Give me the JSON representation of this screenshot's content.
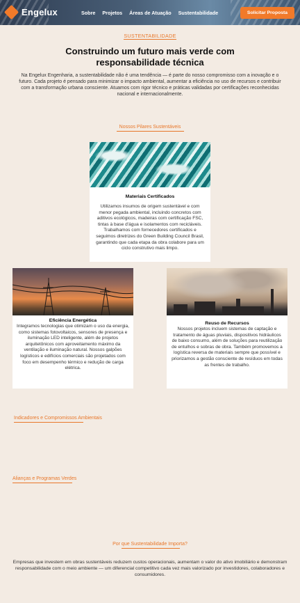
{
  "header": {
    "brand": "Engelux",
    "nav": [
      "Sobre",
      "Projetos",
      "Áreas de Atuação",
      "Sustentabilidade"
    ],
    "cta": "Solicitar Proposta"
  },
  "intro": {
    "eyebrow": "SUSTENTABILIDADE",
    "title": "Construindo um futuro mais verde com responsabilidade técnica",
    "text": "Na Engelux Engenharia, a sustentabilidade não é uma tendência — é parte do nosso compromisso com a inovação e o futuro. Cada projeto é pensado para minimizar o impacto ambiental, aumentar a eficiência no uso de recursos e contribuir com a transformação urbana consciente. Atuamos com rigor técnico e práticas validadas por certificações reconhecidas nacional e internacionalmente."
  },
  "pillars": {
    "heading": "Nossos Pilares Sustentáveis",
    "cards": [
      {
        "title": "Materiais Certificados",
        "text": "Utilizamos insumos de origem sustentável e com menor pegada ambiental, incluindo concretos com aditivos ecológicos, madeiras com certificação FSC, tintas à base d'água e isolamentos com recicláveis. Trabalhamos com fornecedores certificados e seguimos diretrizes do Green Building Council Brasil, garantindo que cada etapa da obra colabore para um ciclo construtivo mais limpo."
      },
      {
        "title": "Eficiência Energética",
        "text": "Integramos tecnologias que otimizam o uso da energia, como sistemas fotovoltaicos, sensores de presença e iluminação LED inteligente, além de projetos arquitetônicos com aproveitamento máximo da ventilação e iluminação natural. Nossos galpões logísticos e edifícios comerciais são projetados com foco em desempenho térmico e redução de carga elétrica."
      },
      {
        "title": "Reuso de Recursos",
        "text": "Nossos projetos incluem sistemas de captação e tratamento de águas pluviais, dispositivos hidráulicos de baixo consumo, além de soluções para reutilização de entulhos e sobras de obra. Também promovemos a logística reversa de materiais sempre que possível e priorizamos a gestão consciente de resíduos em todas as frentes de trabalho."
      }
    ]
  },
  "indicators": {
    "heading": "Indicadores e Compromissos Ambientais"
  },
  "alliances": {
    "heading": "Alianças e Programas Verdes"
  },
  "why": {
    "heading": "Por que Sustentabilidade Importa?",
    "text": "Empresas que investem em obras sustentáveis reduzem custos operacionais, aumentam o valor do ativo imobiliário e demonstram responsabilidade com o meio ambiente — um diferencial competitivo cada vez mais valorizado por investidores, colaboradores e consumidores."
  },
  "colors": {
    "accent": "#f17a2a",
    "background": "#f3ebe3",
    "header": "#3e5670"
  }
}
